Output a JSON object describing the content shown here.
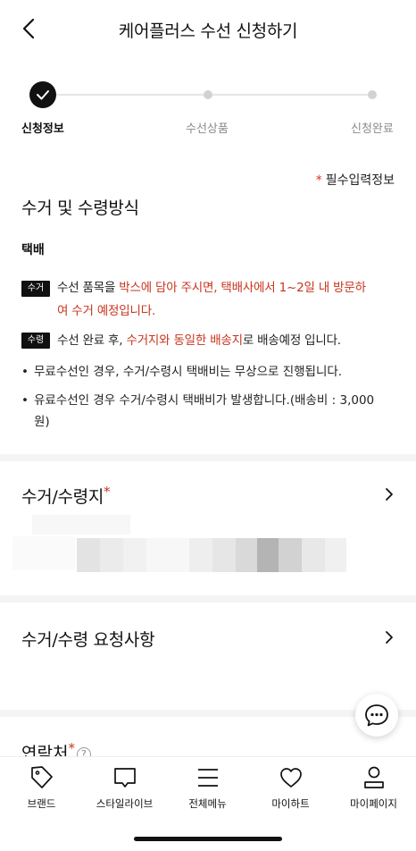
{
  "header": {
    "title": "케어플러스 수선 신청하기"
  },
  "stepper": {
    "steps": [
      {
        "label": "신청정보"
      },
      {
        "label": "수선상품"
      },
      {
        "label": "신청완료"
      }
    ],
    "current": 1
  },
  "required_note": {
    "star": "*",
    "text": "필수입력정보"
  },
  "pickup": {
    "title": "수거 및 수령방식",
    "method": "택배",
    "pickup_tag": "수거",
    "pickup_text_1": "수선 품목을 ",
    "pickup_text_red_1": "박스에 담아 주시면, 택배사에서 1~2일 내 방문하",
    "pickup_text_red_2": "여 수거 예정입니다.",
    "return_tag": "수령",
    "return_text_1": "수선 완료 후, ",
    "return_text_red": "수거지와 동일한 배송지",
    "return_text_2": "로 배송예정 입니다.",
    "bullet_1": "무료수선인 경우, 수거/수령시 택배비는 무상으로 진행됩니다.",
    "bullet_2_line1": "유료수선인 경우 수거/수령시 택배비가 발생합니다.(배송비 : 3,000",
    "bullet_2_line2": "원)",
    "bullet_mark": "•"
  },
  "address": {
    "title": "수거/수령지",
    "star": "*"
  },
  "request": {
    "title": "수거/수령 요청사항"
  },
  "contact": {
    "title": "연락처",
    "star": "*",
    "help": "?"
  },
  "tabbar": {
    "items": [
      {
        "label": "브랜드",
        "icon": "tag-icon"
      },
      {
        "label": "스타일라이브",
        "icon": "chat-icon"
      },
      {
        "label": "전체메뉴",
        "icon": "menu-icon"
      },
      {
        "label": "마이하트",
        "icon": "heart-icon"
      },
      {
        "label": "마이페이지",
        "icon": "person-icon"
      }
    ]
  },
  "colors": {
    "accent_red": "#c8341d",
    "dark": "#111111"
  }
}
